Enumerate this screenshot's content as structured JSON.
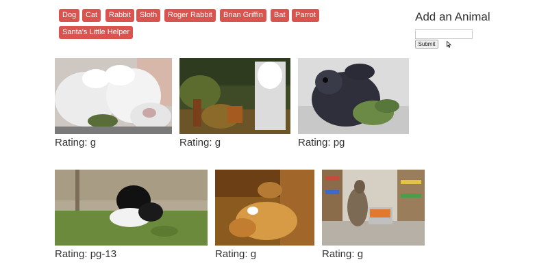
{
  "animal_buttons": [
    "Dog",
    "Cat",
    "Rabbit",
    "Sloth",
    "Roger Rabbit",
    "Brian Griffin",
    "Bat",
    "Parrot",
    "Santa's Little Helper"
  ],
  "form": {
    "title": "Add an Animal",
    "input_value": "",
    "submit_label": "Submit"
  },
  "gifs": [
    {
      "subject": "white-bunnies",
      "rating_label": "Rating: g"
    },
    {
      "subject": "cartoon-forest-scene",
      "rating_label": "Rating: g"
    },
    {
      "subject": "black-rabbit-eating-leaves",
      "rating_label": "Rating: pg"
    },
    {
      "subject": "black-rabbit-on-lawn",
      "rating_label": "Rating: pg-13"
    },
    {
      "subject": "golden-room-scene",
      "rating_label": "Rating: g"
    },
    {
      "subject": "kangaroo-with-shopping-cart",
      "rating_label": "Rating: g"
    }
  ],
  "colors": {
    "button_bg": "#d9534f",
    "button_text": "#ffffff"
  },
  "icons": {
    "cursor": "arrow-cursor-icon"
  }
}
